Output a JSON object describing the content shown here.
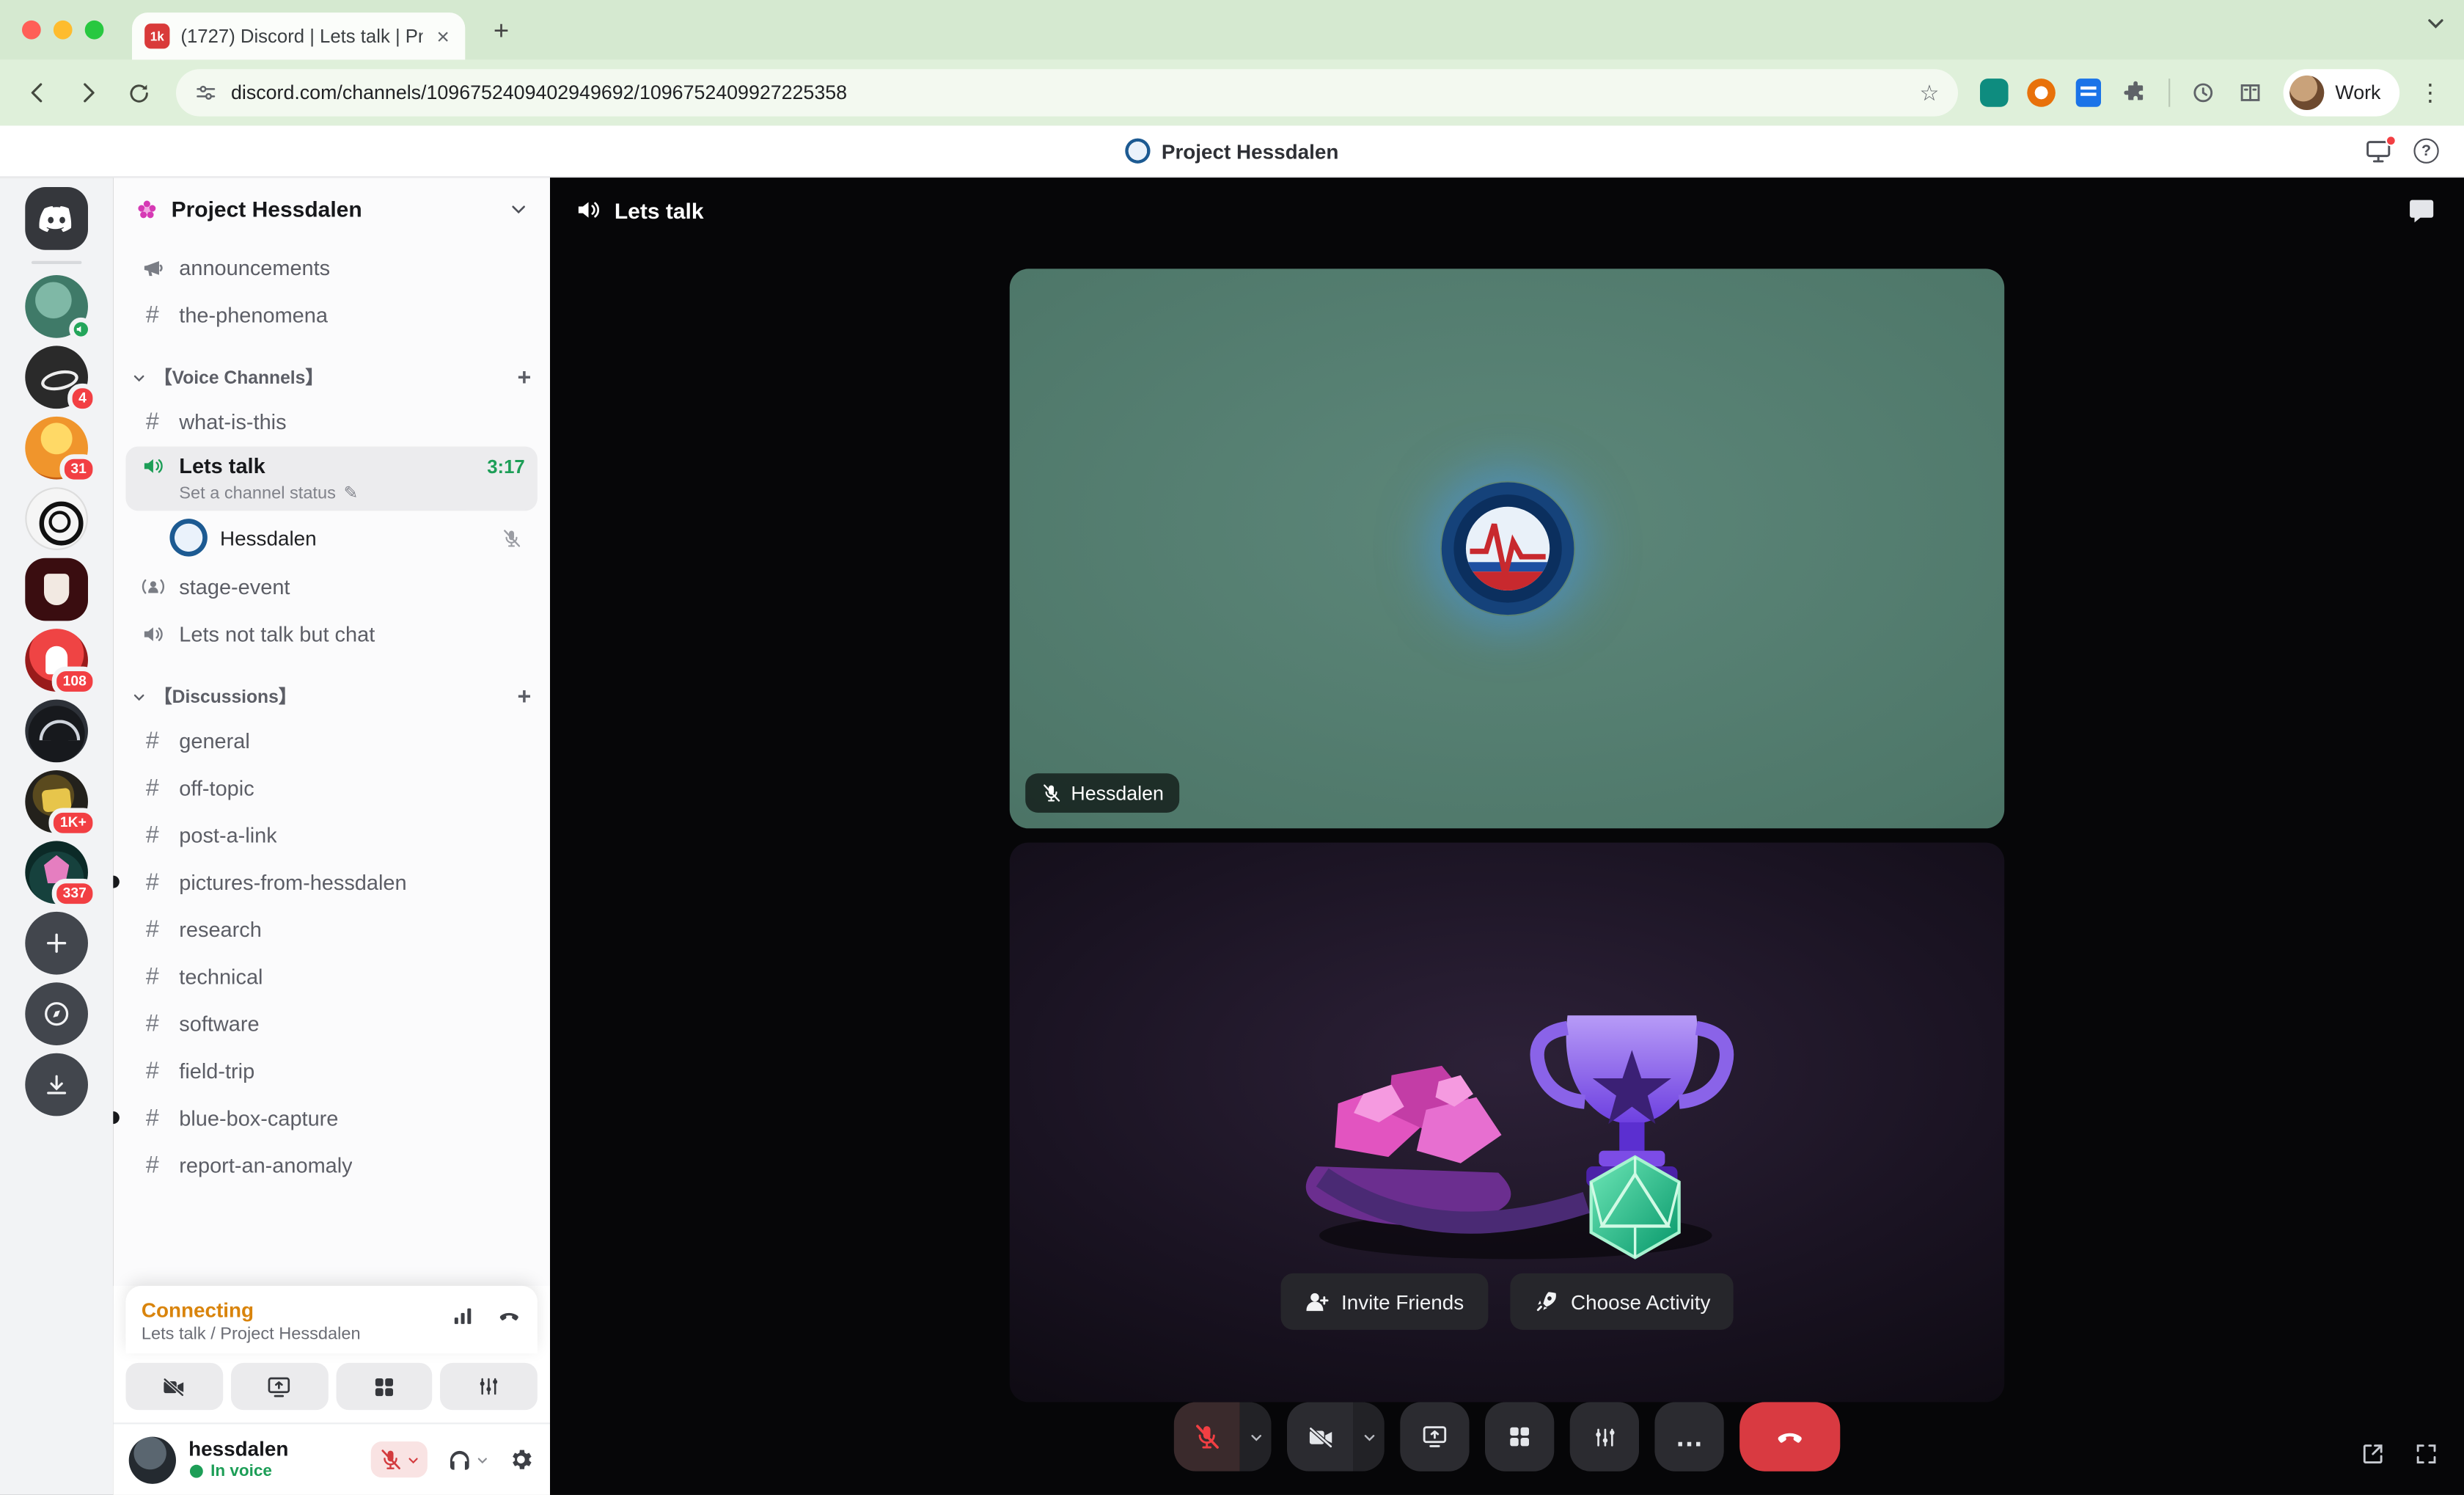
{
  "icons": {
    "hash": "#",
    "plus": "+",
    "close": "×",
    "kebab": "⋮",
    "question": "?",
    "more": "…",
    "star": "☆",
    "pencil": "✎"
  },
  "colors": {
    "accent_green": "#23a55a",
    "danger_red": "#da373c",
    "connecting_amber": "#d9840c",
    "badge_red": "#f23f43",
    "tile_teal": "#4e7769"
  },
  "browser": {
    "tab_title": "(1727) Discord | Lets talk | Pr",
    "tab_badge": "1k",
    "url": "discord.com/channels/1096752409402949692/1096752409927225358",
    "profile_label": "Work"
  },
  "header": {
    "title": "Project Hessdalen"
  },
  "rail": {
    "badges": [
      "4",
      "31",
      "108",
      "1K+",
      "337"
    ]
  },
  "sidebar": {
    "server_name": "Project Hessdalen",
    "announcements": "announcements",
    "the_phenomena": "the-phenomena",
    "voice_section": "【Voice Channels】",
    "what_is_this": "what-is-this",
    "lets_talk": "Lets talk",
    "timer": "3:17",
    "status_hint": "Set a channel status",
    "participant": "Hessdalen",
    "stage_event": "stage-event",
    "lets_not_talk": "Lets not talk but chat",
    "discussions_section": "【Discussions】",
    "discussion_channels": [
      "general",
      "off-topic",
      "post-a-link",
      "pictures-from-hessdalen",
      "research",
      "technical",
      "software",
      "field-trip",
      "blue-box-capture",
      "report-an-anomaly"
    ]
  },
  "panel": {
    "status": "Connecting",
    "location": "Lets talk / Project Hessdalen"
  },
  "user": {
    "name": "hessdalen",
    "status": "In voice"
  },
  "voice": {
    "title": "Lets talk",
    "invite": "Invite Friends",
    "activity": "Choose Activity"
  }
}
